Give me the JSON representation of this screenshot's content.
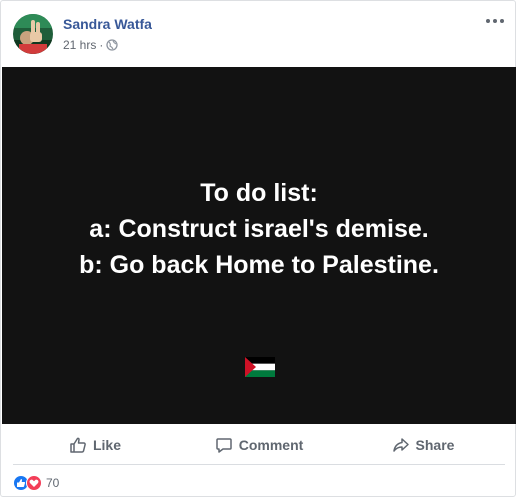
{
  "post": {
    "author": "Sandra Watfa",
    "time": "21 hrs",
    "separator": "·",
    "more_label": "•••",
    "content_lines": [
      "To do list:",
      "a: Construct israel's demise.",
      "b: Go back Home to Palestine."
    ],
    "background_color": "#121212",
    "text_color": "#ffffff",
    "flag_icon": "palestine-flag-icon"
  },
  "actions": {
    "like_label": "Like",
    "comment_label": "Comment",
    "share_label": "Share"
  },
  "reactions": {
    "icons": [
      "like-reaction-icon",
      "love-reaction-icon"
    ],
    "count": "70"
  },
  "colors": {
    "author_link": "#385898",
    "like_blue": "#1877f2",
    "love_red": "#f33e58"
  }
}
